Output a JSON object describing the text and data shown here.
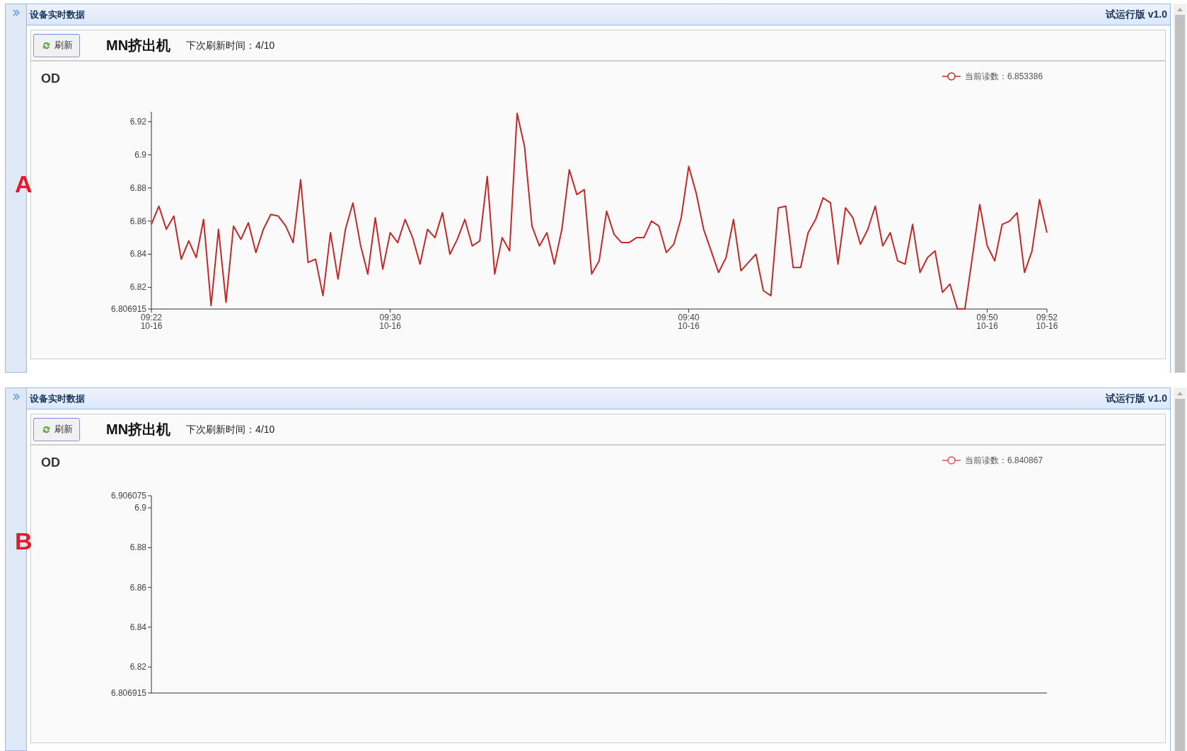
{
  "panels": [
    {
      "label": "A",
      "header_title": "设备实时数据",
      "version": "试运行版 v1.0",
      "refresh_button": "刷新",
      "machine_name": "MN挤出机",
      "next_refresh": "下次刷新时间：4/10",
      "legend": "当前读数：6.853386",
      "chart_data": {
        "type": "line",
        "title": "OD",
        "ylim": [
          6.806915,
          6.926
        ],
        "yticks": [
          {
            "value": 6.806915,
            "label": "6.806915"
          },
          {
            "value": 6.82,
            "label": "6.82"
          },
          {
            "value": 6.84,
            "label": "6.84"
          },
          {
            "value": 6.86,
            "label": "6.86"
          },
          {
            "value": 6.88,
            "label": "6.88"
          },
          {
            "value": 6.9,
            "label": "6.9"
          },
          {
            "value": 6.92,
            "label": "6.92"
          }
        ],
        "categories": [
          "09:22 10-16",
          null,
          null,
          null,
          null,
          null,
          null,
          null,
          null,
          null,
          null,
          null,
          null,
          null,
          null,
          null,
          null,
          null,
          null,
          null,
          null,
          null,
          null,
          null,
          null,
          null,
          null,
          null,
          null,
          null,
          null,
          null,
          "09:30 10-16",
          null,
          null,
          null,
          null,
          null,
          null,
          null,
          null,
          null,
          null,
          null,
          null,
          null,
          null,
          null,
          null,
          null,
          null,
          null,
          null,
          null,
          null,
          null,
          null,
          null,
          null,
          null,
          null,
          null,
          null,
          null,
          null,
          null,
          null,
          null,
          null,
          null,
          null,
          null,
          "09:40 10-16",
          null,
          null,
          null,
          null,
          null,
          null,
          null,
          null,
          null,
          null,
          null,
          null,
          null,
          null,
          null,
          null,
          null,
          null,
          null,
          null,
          null,
          null,
          null,
          null,
          null,
          null,
          null,
          null,
          null,
          null,
          null,
          null,
          null,
          null,
          null,
          null,
          null,
          null,
          null,
          "09:50 10-16",
          null,
          null,
          null,
          null,
          null,
          null,
          null,
          "09:52 10-16"
        ],
        "series": [
          {
            "color": "#c62828",
            "values": [
              6.858,
              6.869,
              6.855,
              6.863,
              6.837,
              6.848,
              6.838,
              6.861,
              6.809,
              6.855,
              6.811,
              6.857,
              6.849,
              6.859,
              6.841,
              6.855,
              6.864,
              6.863,
              6.857,
              6.847,
              6.885,
              6.835,
              6.837,
              6.815,
              6.853,
              6.825,
              6.855,
              6.871,
              6.846,
              6.828,
              6.862,
              6.831,
              6.853,
              6.847,
              6.861,
              6.85,
              6.834,
              6.855,
              6.85,
              6.865,
              6.84,
              6.849,
              6.861,
              6.845,
              6.848,
              6.887,
              6.828,
              6.85,
              6.842,
              6.925,
              6.905,
              6.857,
              6.845,
              6.853,
              6.834,
              6.855,
              6.891,
              6.876,
              6.879,
              6.828,
              6.836,
              6.866,
              6.852,
              6.847,
              6.847,
              6.85,
              6.85,
              6.86,
              6.857,
              6.841,
              6.846,
              6.862,
              6.893,
              6.877,
              6.855,
              6.842,
              6.829,
              6.838,
              6.861,
              6.83,
              6.835,
              6.84,
              6.818,
              6.815,
              6.868,
              6.869,
              6.832,
              6.832,
              6.853,
              6.861,
              6.874,
              6.871,
              6.834,
              6.868,
              6.862,
              6.846,
              6.855,
              6.869,
              6.845,
              6.853,
              6.836,
              6.834,
              6.858,
              6.829,
              6.838,
              6.842,
              6.817,
              6.822,
              6.807,
              6.807,
              6.838,
              6.87,
              6.845,
              6.836,
              6.858,
              6.86,
              6.865,
              6.829,
              6.842,
              6.873,
              6.853
            ]
          }
        ]
      }
    },
    {
      "label": "B",
      "header_title": "设备实时数据",
      "version": "试运行版 v1.0",
      "refresh_button": "刷新",
      "machine_name": "MN挤出机",
      "next_refresh": "下次刷新时间：4/10",
      "legend": "当前读数：6.840867",
      "empty_chart": {
        "title": "OD",
        "y_axis_labels": [
          "6.906075",
          "6.9",
          "6.88",
          "6.86",
          "6.84",
          "6.82",
          "6.806915"
        ]
      }
    }
  ]
}
